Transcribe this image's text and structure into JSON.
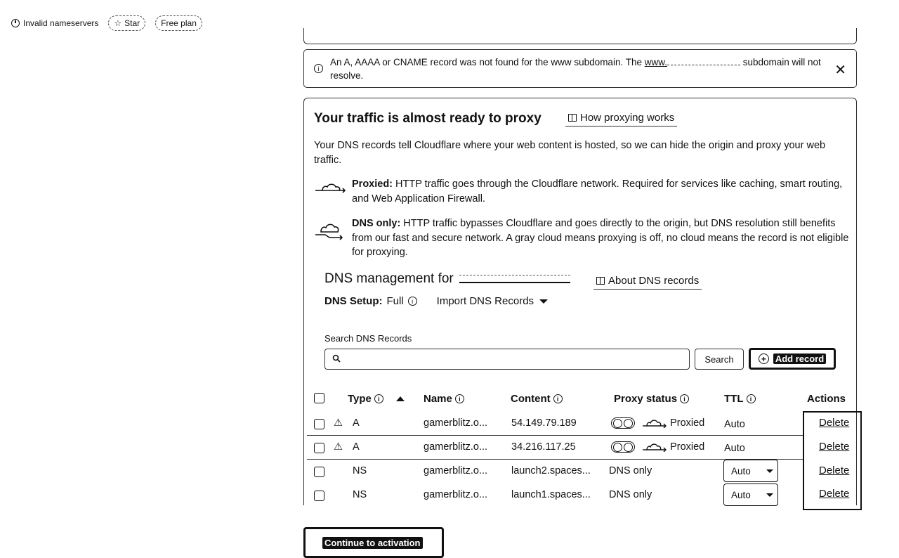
{
  "topbar": {
    "status": "Invalid nameservers",
    "star": "Star",
    "plan": "Free plan"
  },
  "alert": {
    "message_start": "An A, AAAA or CNAME record was not found for the www subdomain. The ",
    "link_text": "www.",
    "message_end": " subdomain will not resolve."
  },
  "proxy_card": {
    "title": "Your traffic is almost ready to proxy",
    "how_link": "How proxying works",
    "description": "Your DNS records tell Cloudflare where your web content is hosted, so we can hide the origin and proxy your web traffic.",
    "proxied_label": "Proxied:",
    "proxied_text": " HTTP traffic goes through the Cloudflare network. Required for services like caching, smart routing, and Web Application Firewall.",
    "dnsonly_label": "DNS only:",
    "dnsonly_text": " HTTP traffic bypasses Cloudflare and goes directly to the origin, but DNS resolution still benefits from our fast and secure network. A gray cloud means proxying is off, no cloud means the record is not eligible for proxying."
  },
  "dns": {
    "title": "DNS management for",
    "about_link": "About DNS records",
    "setup_label": "DNS Setup:",
    "setup_value": "Full",
    "import_label": "Import DNS Records",
    "search_label": "Search DNS Records",
    "search_placeholder": "",
    "search_button": "Search",
    "add_button": "Add record"
  },
  "table": {
    "headers": {
      "type": "Type",
      "name": "Name",
      "content": "Content",
      "proxy": "Proxy status",
      "ttl": "TTL",
      "actions": "Actions"
    },
    "rows": [
      {
        "warning": "⚠",
        "type": "A",
        "name": "gamerblitz.o...",
        "content": "54.149.79.189",
        "proxy": "Proxied",
        "ttl": "Auto",
        "action": "Delete"
      },
      {
        "warning": "⚠",
        "type": "A",
        "name": "gamerblitz.o...",
        "content": "34.216.117.25",
        "proxy": "Proxied",
        "ttl": "Auto",
        "action": "Delete"
      },
      {
        "warning": "",
        "type": "NS",
        "name": "gamerblitz.o...",
        "content": "launch2.spaces...",
        "proxy": "DNS only",
        "ttl": "Auto",
        "action": "Delete"
      },
      {
        "warning": "",
        "type": "NS",
        "name": "gamerblitz.o...",
        "content": "launch1.spaces...",
        "proxy": "DNS only",
        "ttl": "Auto",
        "action": "Delete"
      }
    ]
  },
  "footer": {
    "continue_button": "Continue to activation"
  }
}
